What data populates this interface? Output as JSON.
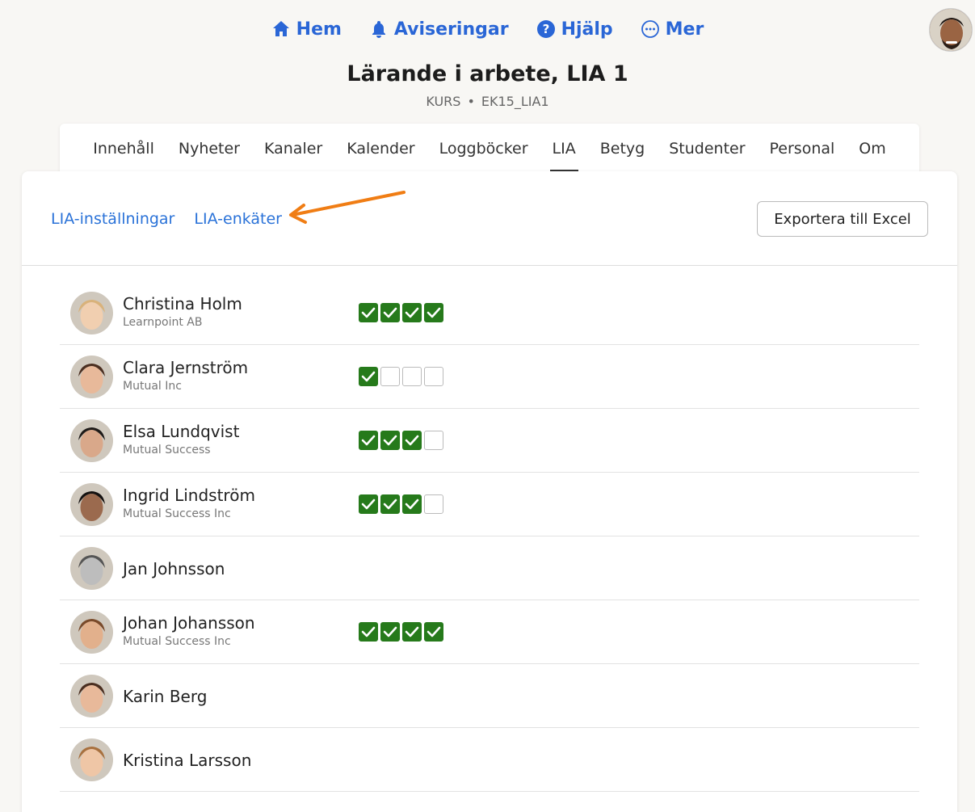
{
  "nav": {
    "items": [
      {
        "label": "Hem",
        "icon": "home-icon"
      },
      {
        "label": "Aviseringar",
        "icon": "bell-icon"
      },
      {
        "label": "Hjälp",
        "icon": "help-icon"
      },
      {
        "label": "Mer",
        "icon": "more-icon"
      }
    ]
  },
  "course": {
    "title": "Lärande i arbete, LIA 1",
    "type": "KURS",
    "code": "EK15_LIA1"
  },
  "tabs": [
    {
      "label": "Innehåll"
    },
    {
      "label": "Nyheter"
    },
    {
      "label": "Kanaler"
    },
    {
      "label": "Kalender"
    },
    {
      "label": "Loggböcker"
    },
    {
      "label": "LIA",
      "active": true
    },
    {
      "label": "Betyg"
    },
    {
      "label": "Studenter"
    },
    {
      "label": "Personal"
    },
    {
      "label": "Om"
    }
  ],
  "panel": {
    "settings_link": "LIA-inställningar",
    "surveys_link": "LIA-enkäter",
    "export_label": "Exportera till Excel"
  },
  "colors": {
    "accent": "#2a66d6",
    "check_done": "#267a1b",
    "arrow": "#f07d14"
  },
  "students": [
    {
      "name": "Christina Holm",
      "company": "Learnpoint AB",
      "checks": [
        true,
        true,
        true,
        true
      ],
      "skin": "#f1cfb0",
      "hair": "#d9b27a"
    },
    {
      "name": "Clara Jernström",
      "company": "Mutual Inc",
      "checks": [
        true,
        false,
        false,
        false
      ],
      "skin": "#e8b99a",
      "hair": "#4a2e20"
    },
    {
      "name": "Elsa Lundqvist",
      "company": "Mutual Success",
      "checks": [
        true,
        true,
        true,
        false
      ],
      "skin": "#d9a88a",
      "hair": "#1e1a18"
    },
    {
      "name": "Ingrid Lindström",
      "company": "Mutual Success Inc",
      "checks": [
        true,
        true,
        true,
        false
      ],
      "skin": "#9b6a4e",
      "hair": "#141110"
    },
    {
      "name": "Jan Johnsson",
      "company": "",
      "checks": [],
      "skin": "#bdbdbd",
      "hair": "#555555"
    },
    {
      "name": "Johan Johansson",
      "company": "Mutual Success Inc",
      "checks": [
        true,
        true,
        true,
        true
      ],
      "skin": "#e2b08c",
      "hair": "#7a4a2a"
    },
    {
      "name": "Karin Berg",
      "company": "",
      "checks": [],
      "skin": "#e8b99a",
      "hair": "#4a2e20"
    },
    {
      "name": "Kristina Larsson",
      "company": "",
      "checks": [],
      "skin": "#efc6a6",
      "hair": "#a8703e"
    }
  ]
}
